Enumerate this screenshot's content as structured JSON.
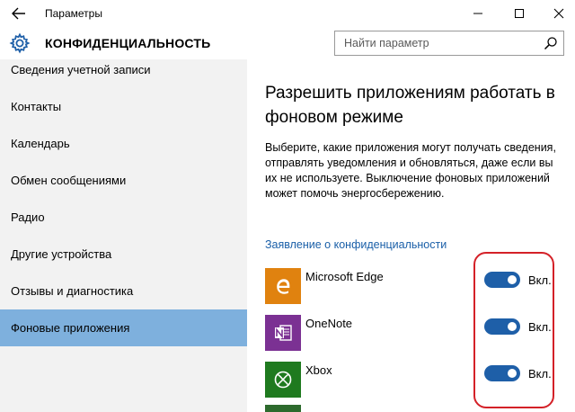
{
  "window": {
    "title": "Параметры",
    "back_icon": "arrow-left-icon",
    "minimize_icon": "minimize-icon",
    "maximize_icon": "maximize-icon",
    "close_icon": "close-icon"
  },
  "header": {
    "icon": "gear-icon",
    "title": "КОНФИДЕНЦИАЛЬНОСТЬ",
    "search_placeholder": "Найти параметр",
    "search_value": ""
  },
  "sidebar": {
    "items": [
      {
        "label": "Сведения учетной записи",
        "active": false
      },
      {
        "label": "Контакты",
        "active": false
      },
      {
        "label": "Календарь",
        "active": false
      },
      {
        "label": "Обмен сообщениями",
        "active": false
      },
      {
        "label": "Радио",
        "active": false
      },
      {
        "label": "Другие устройства",
        "active": false
      },
      {
        "label": "Отзывы и диагностика",
        "active": false
      },
      {
        "label": "Фоновые приложения",
        "active": true
      }
    ]
  },
  "main": {
    "heading": "Разрешить приложениям работать в фоновом режиме",
    "description": "Выберите, какие приложения могут получать сведения, отправлять уведомления и обновляться, даже если вы их не используете. Выключение фоновых приложений может помочь энергосбережению.",
    "privacy_link": "Заявление о конфиденциальности",
    "apps": [
      {
        "name": "Microsoft Edge",
        "icon": "edge-icon",
        "tile_color": "#e0820f",
        "toggle_on": true,
        "toggle_label": "Вкл."
      },
      {
        "name": "OneNote",
        "icon": "onenote-icon",
        "tile_color": "#7b3193",
        "toggle_on": true,
        "toggle_label": "Вкл."
      },
      {
        "name": "Xbox",
        "icon": "xbox-icon",
        "tile_color": "#1f7a1f",
        "toggle_on": true,
        "toggle_label": "Вкл."
      }
    ]
  },
  "colors": {
    "accent": "#1e5fa8",
    "sidebar_bg": "#f2f2f2",
    "sidebar_active": "#7eb0dd",
    "link": "#1a5fa8",
    "annotation": "#d42128"
  }
}
